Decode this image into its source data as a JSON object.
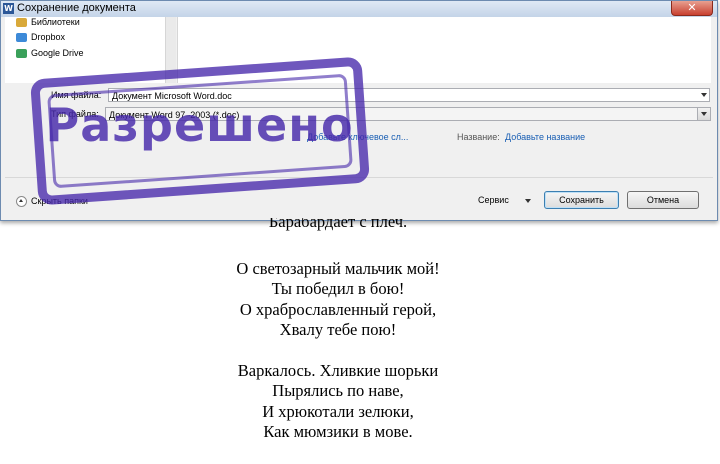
{
  "dialog": {
    "title": "Сохранение документа",
    "close_glyph": "✕",
    "nav_items": [
      {
        "label": "Библиотеки",
        "icon": "library-icon",
        "color": "#d9a93a"
      },
      {
        "label": "Dropbox",
        "icon": "dropbox-icon",
        "color": "#3d8ad8"
      },
      {
        "label": "Google Drive",
        "icon": "google-drive-icon",
        "color": "#3aa05a"
      }
    ],
    "filename_label": "Имя файла:",
    "filename_value": "Документ Microsoft Word.doc",
    "filetype_label": "Тип файла:",
    "filetype_value": "Документ Word 97–2003 (*.doc)",
    "keywords_link": "Добавьте ключевое сл...",
    "name_label": "Название:",
    "name_link": "Добавьте название",
    "hide_folders_label": "Скрыть папки",
    "service_label": "Сервис",
    "save_button": "Сохранить",
    "cancel_button": "Отмена"
  },
  "stamp": {
    "text": "Разрешено",
    "color": "#4628aa"
  },
  "poem": {
    "stanzas": [
      [
        "Барабардает с плеч."
      ],
      [
        "О светозарный мальчик мой!",
        "Ты победил в бою!",
        "О храброславленный герой,",
        "Хвалу тебе пою!"
      ],
      [
        "Варкалось. Хливкие шорьки",
        "Пырялись по наве,",
        "И хрюкотали зелюки,",
        "Как мюмзики в мове."
      ]
    ]
  }
}
